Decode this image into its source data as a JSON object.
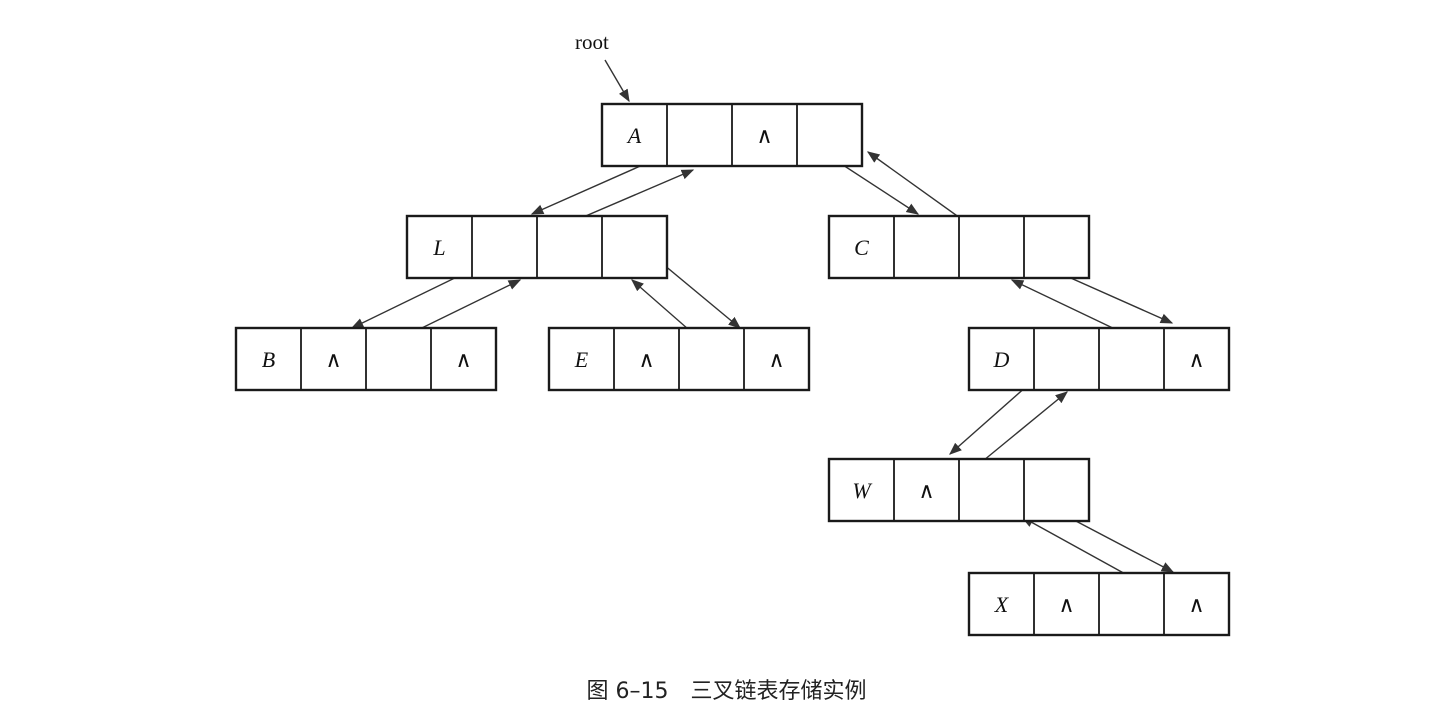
{
  "root_label": "root",
  "null_symbol": "∧",
  "caption": "图 6–15　三叉链表存储实例",
  "nodes": [
    {
      "id": "A",
      "cells": [
        "A",
        "",
        "∧",
        ""
      ]
    },
    {
      "id": "L",
      "cells": [
        "L",
        "",
        "",
        ""
      ]
    },
    {
      "id": "C",
      "cells": [
        "C",
        "",
        "",
        ""
      ]
    },
    {
      "id": "B",
      "cells": [
        "B",
        "∧",
        "",
        "∧"
      ]
    },
    {
      "id": "E",
      "cells": [
        "E",
        "∧",
        "",
        "∧"
      ]
    },
    {
      "id": "D",
      "cells": [
        "D",
        "",
        "",
        "∧"
      ]
    },
    {
      "id": "W",
      "cells": [
        "W",
        "∧",
        "",
        ""
      ]
    },
    {
      "id": "X",
      "cells": [
        "X",
        "∧",
        "",
        "∧"
      ]
    }
  ],
  "edges": [
    {
      "from": "A",
      "to": "L",
      "field": "lchild"
    },
    {
      "from": "L",
      "to": "A",
      "field": "parent"
    },
    {
      "from": "A",
      "to": "C",
      "field": "rchild"
    },
    {
      "from": "C",
      "to": "A",
      "field": "parent"
    },
    {
      "from": "L",
      "to": "B",
      "field": "lchild"
    },
    {
      "from": "B",
      "to": "L",
      "field": "parent"
    },
    {
      "from": "L",
      "to": "E",
      "field": "rchild"
    },
    {
      "from": "E",
      "to": "L",
      "field": "parent"
    },
    {
      "from": "C",
      "to": "D",
      "field": "rchild"
    },
    {
      "from": "D",
      "to": "C",
      "field": "parent"
    },
    {
      "from": "D",
      "to": "W",
      "field": "lchild"
    },
    {
      "from": "W",
      "to": "D",
      "field": "parent"
    },
    {
      "from": "W",
      "to": "X",
      "field": "rchild"
    },
    {
      "from": "X",
      "to": "W",
      "field": "parent"
    }
  ]
}
